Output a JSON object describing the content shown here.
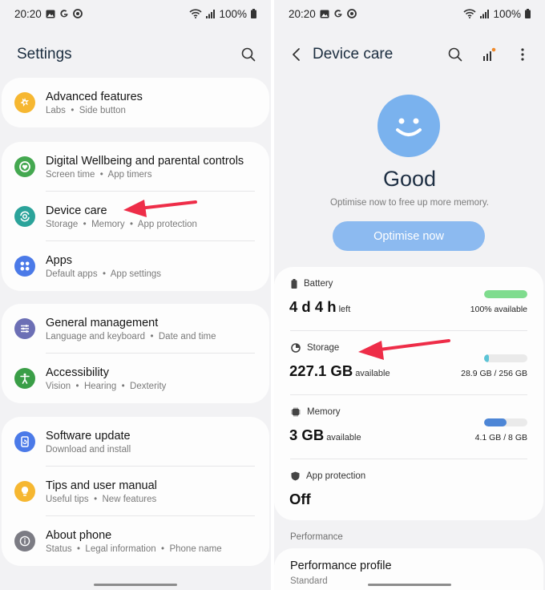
{
  "status_bar": {
    "time": "20:20",
    "battery": "100%"
  },
  "left": {
    "title": "Settings",
    "groups": [
      [
        {
          "title": "Advanced features",
          "sub": [
            "Labs",
            "Side button"
          ],
          "icon": "puzzle-icon",
          "color": "#f6b731"
        }
      ],
      [
        {
          "title": "Digital Wellbeing and parental controls",
          "sub": [
            "Screen time",
            "App timers"
          ],
          "icon": "wellbeing-icon",
          "color": "#44a850"
        },
        {
          "title": "Device care",
          "sub": [
            "Storage",
            "Memory",
            "App protection"
          ],
          "icon": "device-care-icon",
          "color": "#2ba39a"
        },
        {
          "title": "Apps",
          "sub": [
            "Default apps",
            "App settings"
          ],
          "icon": "apps-icon",
          "color": "#4b7ae8"
        }
      ],
      [
        {
          "title": "General management",
          "sub": [
            "Language and keyboard",
            "Date and time"
          ],
          "icon": "sliders-icon",
          "color": "#6c6fb5"
        },
        {
          "title": "Accessibility",
          "sub": [
            "Vision",
            "Hearing",
            "Dexterity"
          ],
          "icon": "accessibility-icon",
          "color": "#3a9e47"
        }
      ],
      [
        {
          "title": "Software update",
          "sub": [
            "Download and install"
          ],
          "icon": "update-icon",
          "color": "#4b7ae8"
        },
        {
          "title": "Tips and user manual",
          "sub": [
            "Useful tips",
            "New features"
          ],
          "icon": "bulb-icon",
          "color": "#f6b731"
        },
        {
          "title": "About phone",
          "sub": [
            "Status",
            "Legal information",
            "Phone name"
          ],
          "icon": "info-icon",
          "color": "#7c7c84"
        }
      ]
    ]
  },
  "right": {
    "title": "Device care",
    "status": "Good",
    "hint": "Optimise now to free up more memory.",
    "optimise_label": "Optimise now",
    "items": [
      {
        "label": "Battery",
        "icon": "battery-icon",
        "big": "4 d 4 h",
        "small": "left",
        "right": "100% available",
        "fill": 1.0,
        "color": "#7fdc8e"
      },
      {
        "label": "Storage",
        "icon": "storage-icon",
        "big": "227.1 GB",
        "small": "available",
        "right": "28.9 GB / 256 GB",
        "fill": 0.113,
        "color": "#5cc4d6"
      },
      {
        "label": "Memory",
        "icon": "memory-icon",
        "big": "3 GB",
        "small": "available",
        "right": "4.1 GB / 8 GB",
        "fill": 0.51,
        "color": "#4d86d6"
      },
      {
        "label": "App protection",
        "icon": "shield-icon",
        "big": "Off",
        "small": "",
        "right": "",
        "fill": null,
        "color": ""
      }
    ],
    "section": "Performance",
    "perf_title": "Performance profile",
    "perf_sub": "Standard"
  }
}
